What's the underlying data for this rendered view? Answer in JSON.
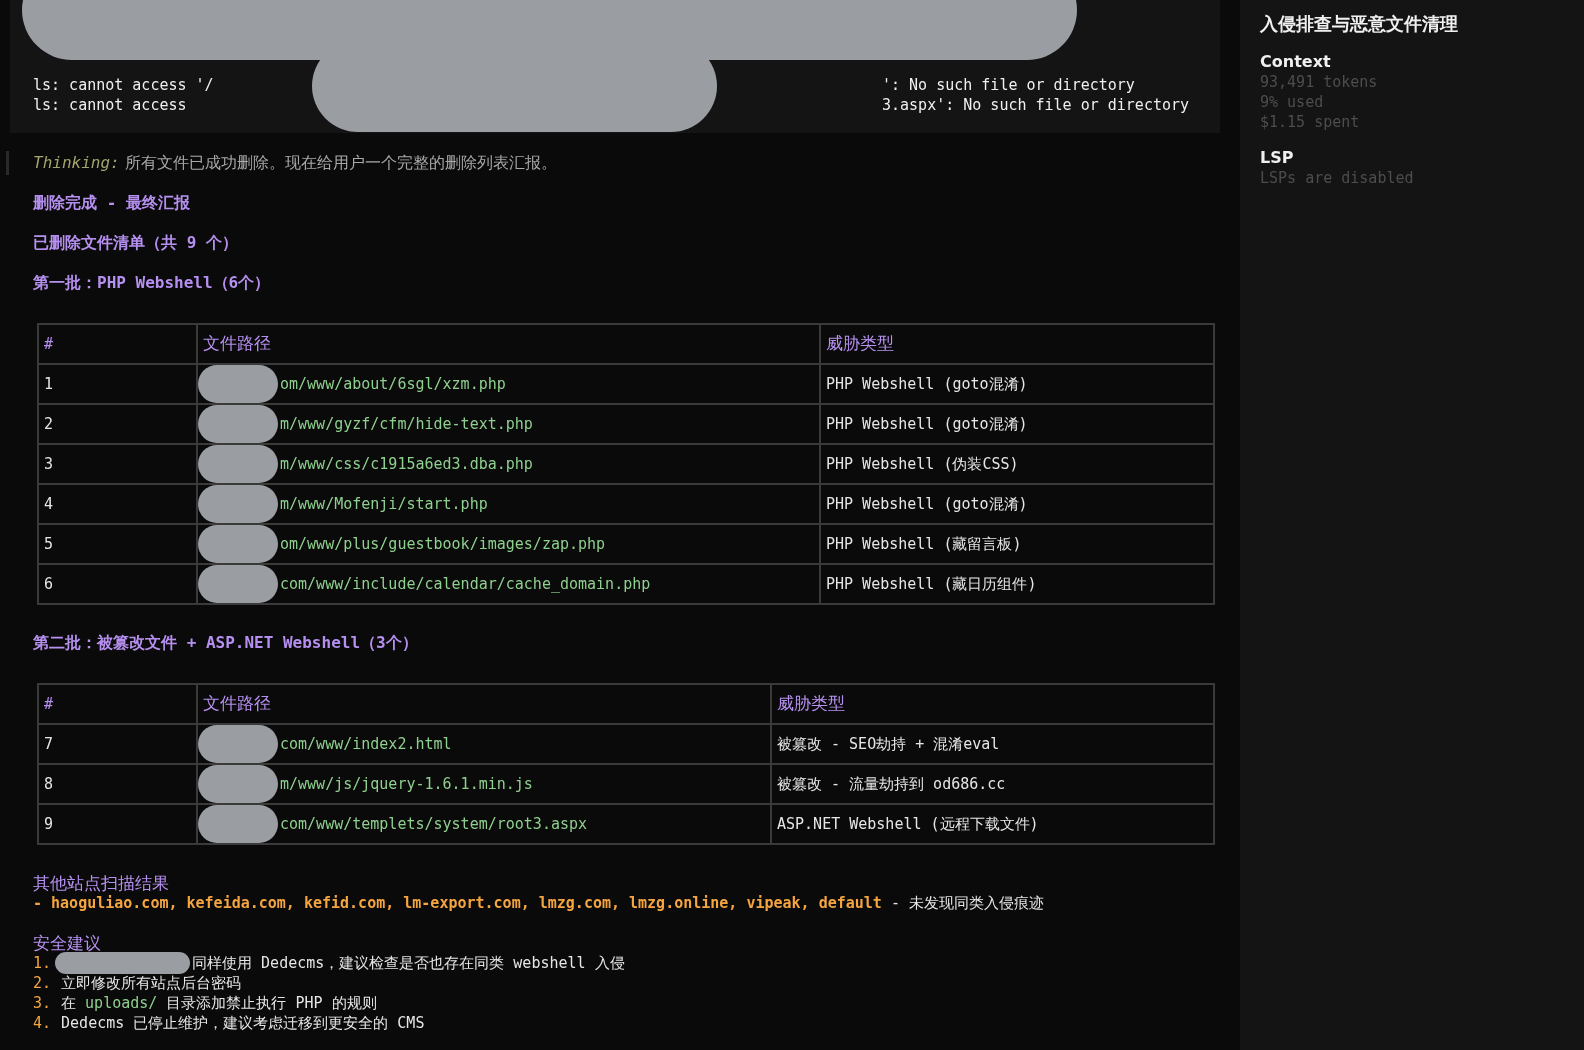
{
  "terminal_output": [
    {
      "before": "ls: cannot access '/",
      "after": "': No such file or directory"
    },
    {
      "before": "ls: cannot access",
      "after": "3.aspx': No such file or directory"
    }
  ],
  "thinking": {
    "label": "Thinking:",
    "text": "所有文件已成功删除。现在给用户一个完整的删除列表汇报。"
  },
  "title": "删除完成 - 最终汇报",
  "subtitle": "已删除文件清单（共 9 个）",
  "tables": [
    {
      "heading": "第一批：PHP Webshell（6个）",
      "columns": [
        "#",
        "文件路径",
        "威胁类型"
      ],
      "rows": [
        {
          "num": "1",
          "path": "om/www/about/6sgl/xzm.php",
          "type": "PHP Webshell (goto混淆)"
        },
        {
          "num": "2",
          "path": "m/www/gyzf/cfm/hide-text.php",
          "type": "PHP Webshell (goto混淆)"
        },
        {
          "num": "3",
          "path": "m/www/css/c1915a6ed3.dba.php",
          "type": "PHP Webshell (伪装CSS)"
        },
        {
          "num": "4",
          "path": "m/www/Mofenji/start.php",
          "type": "PHP Webshell (goto混淆)"
        },
        {
          "num": "5",
          "path": "om/www/plus/guestbook/images/zap.php",
          "type": "PHP Webshell (藏留言板)"
        },
        {
          "num": "6",
          "path": "com/www/include/calendar/cache_domain.php",
          "type": "PHP Webshell (藏日历组件)"
        }
      ]
    },
    {
      "heading": "第二批：被篡改文件 + ASP.NET Webshell（3个）",
      "columns": [
        "#",
        "文件路径",
        "威胁类型"
      ],
      "rows": [
        {
          "num": "7",
          "path": "com/www/index2.html",
          "type": "被篡改 - SEO劫持 + 混淆eval"
        },
        {
          "num": "8",
          "path": "m/www/js/jquery-1.6.1.min.js",
          "type": "被篡改 - 流量劫持到 od686.cc"
        },
        {
          "num": "9",
          "path": "com/www/templets/system/root3.aspx",
          "type": "ASP.NET Webshell (远程下载文件)"
        }
      ]
    }
  ],
  "other_sites": {
    "heading": "其他站点扫描结果",
    "sites": "- haoguliao.com, kefeida.com, kefid.com, lm-export.com, lmzg.com, lmzg.online, vipeak, default",
    "result": " - 未发现同类入侵痕迹"
  },
  "advice": {
    "heading": "安全建议",
    "items": [
      {
        "num": "1.",
        "redacted": true,
        "parts": [
          {
            "kind": "text",
            "text": "同样使用 Dedecms，建议检查是否也存在同类 webshell 入侵"
          }
        ]
      },
      {
        "num": "2.",
        "redacted": false,
        "parts": [
          {
            "kind": "text",
            "text": "立即修改所有站点后台密码"
          }
        ]
      },
      {
        "num": "3.",
        "redacted": false,
        "parts": [
          {
            "kind": "text",
            "text": "在 "
          },
          {
            "kind": "code",
            "text": "uploads/"
          },
          {
            "kind": "text",
            "text": " 目录添加禁止执行 PHP 的规则"
          }
        ]
      },
      {
        "num": "4.",
        "redacted": false,
        "parts": [
          {
            "kind": "text",
            "text": "Dedecms 已停止维护，建议考虑迁移到更安全的 CMS"
          }
        ]
      }
    ]
  },
  "sidebar": {
    "title": "入侵排查与恶意文件清理",
    "sections": [
      {
        "heading": "Context",
        "lines": [
          "93,491 tokens",
          "9% used",
          "$1.15 spent"
        ]
      },
      {
        "heading": "LSP",
        "lines": [
          "LSPs are disabled"
        ]
      }
    ]
  }
}
